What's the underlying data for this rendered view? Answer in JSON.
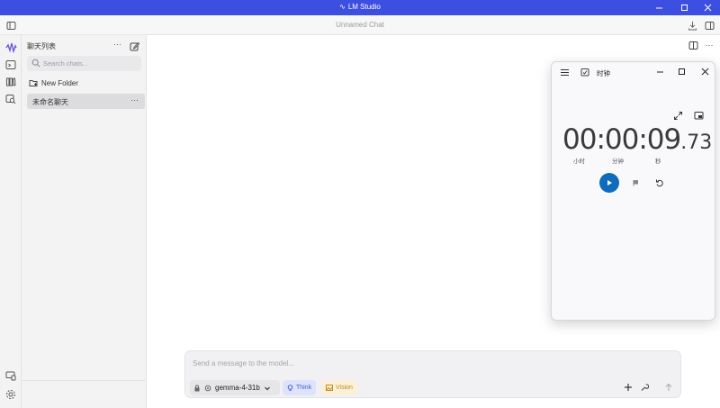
{
  "app": {
    "title": "LM Studio",
    "accent": "#3c4fe0"
  },
  "window_controls": [
    "minimize-icon",
    "maximize-icon",
    "close-icon"
  ],
  "header": {
    "chat_title": "Unnamed Chat"
  },
  "sidebar": {
    "title": "聊天列表",
    "more": "···",
    "search_placeholder": "Search chats...",
    "new_folder": "New Folder",
    "chats": [
      {
        "label": "未命名聊天",
        "more": "···"
      }
    ]
  },
  "composer": {
    "placeholder": "Send a message to the model...",
    "model": "gemma-4-31b",
    "think": "Think",
    "vision": "Vision"
  },
  "clock_app": {
    "title": "时钟",
    "time_main": "00:00:09",
    "time_frac": ".73",
    "units": {
      "hours": "小时",
      "minutes": "分钟",
      "seconds": "秒"
    },
    "play_color": "#0f6cbd"
  }
}
